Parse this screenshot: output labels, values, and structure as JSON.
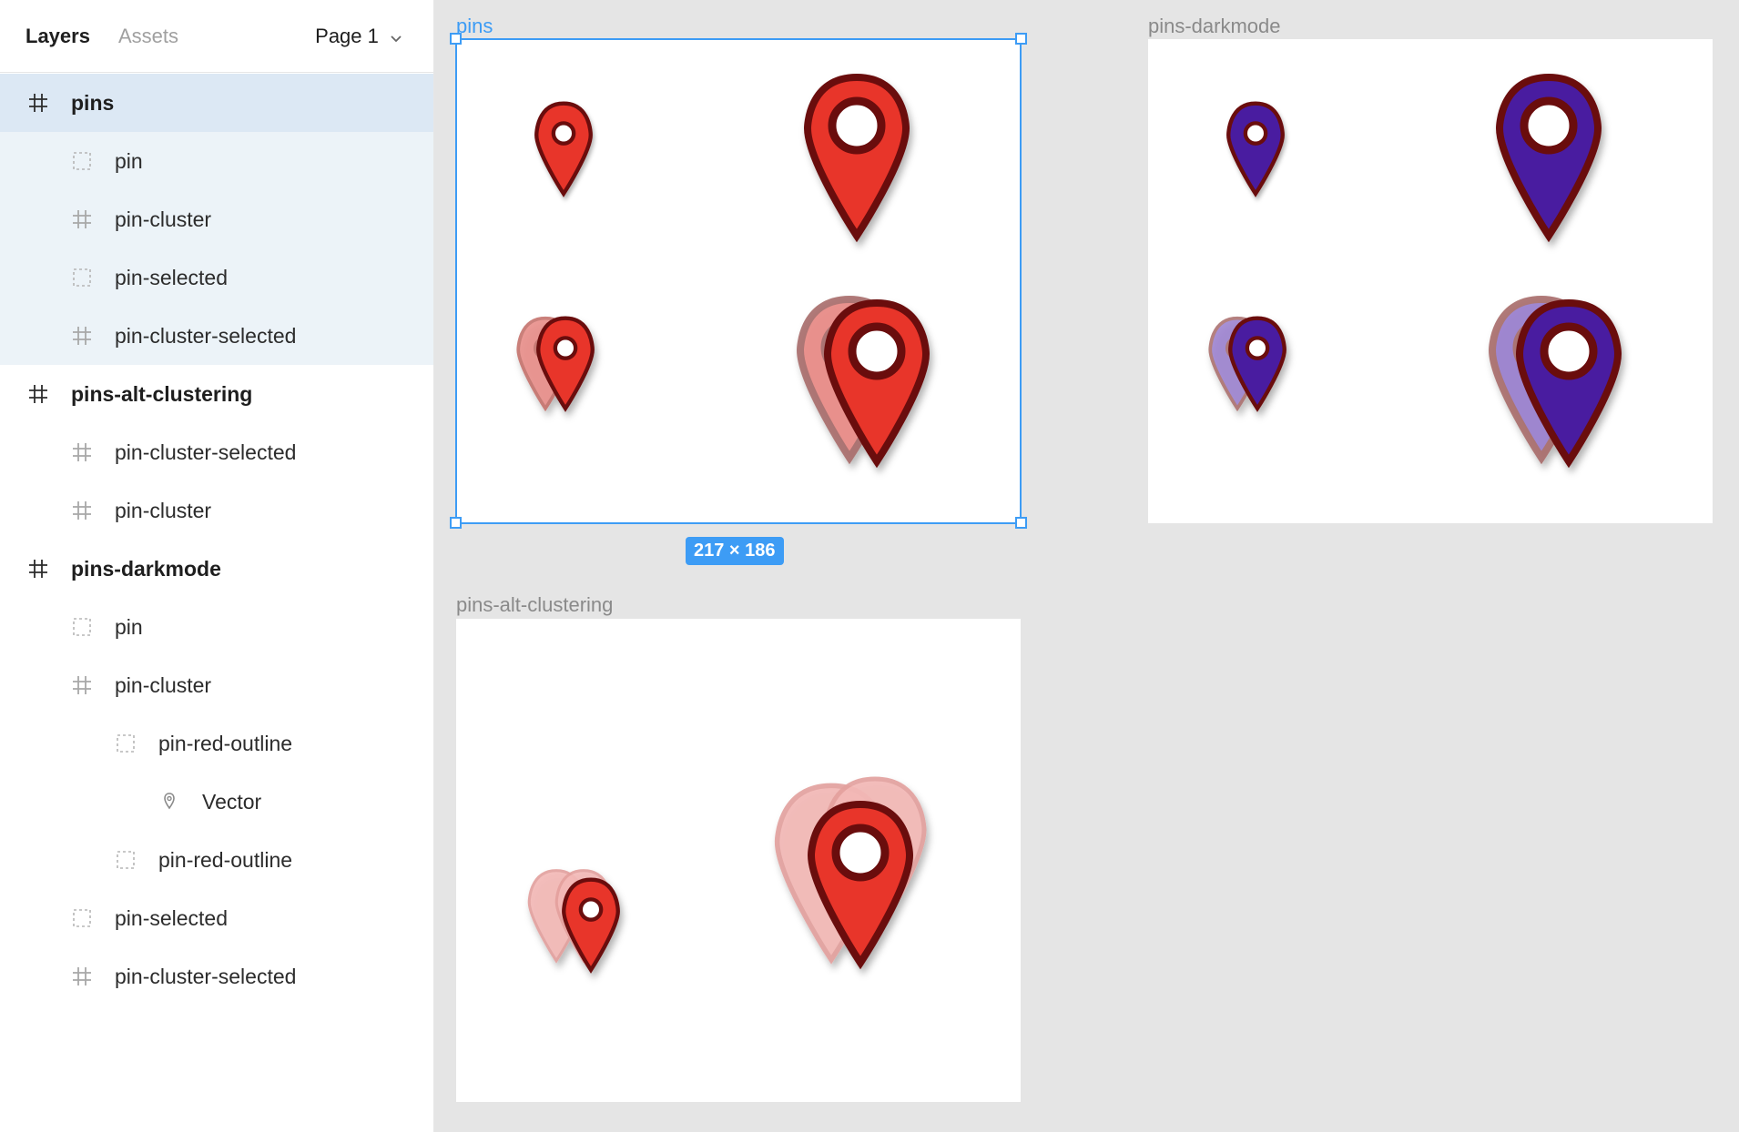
{
  "panel": {
    "tabs": {
      "layers": "Layers",
      "assets": "Assets"
    },
    "page_select": "Page 1",
    "layers": [
      {
        "label": "pins",
        "icon": "frame-icon",
        "indent": 0,
        "top_level": true,
        "state": "selected"
      },
      {
        "label": "pin",
        "icon": "component-icon",
        "indent": 1,
        "state": "child-selected"
      },
      {
        "label": "pin-cluster",
        "icon": "frame-icon",
        "indent": 1,
        "state": "child-selected"
      },
      {
        "label": "pin-selected",
        "icon": "component-icon",
        "indent": 1,
        "state": "child-selected"
      },
      {
        "label": "pin-cluster-selected",
        "icon": "frame-icon",
        "indent": 1,
        "state": "child-selected"
      },
      {
        "label": "pins-alt-clustering",
        "icon": "frame-icon",
        "indent": 0,
        "top_level": true,
        "state": ""
      },
      {
        "label": "pin-cluster-selected",
        "icon": "frame-icon",
        "indent": 1,
        "state": ""
      },
      {
        "label": "pin-cluster",
        "icon": "frame-icon",
        "indent": 1,
        "state": ""
      },
      {
        "label": "pins-darkmode",
        "icon": "frame-icon",
        "indent": 0,
        "top_level": true,
        "state": ""
      },
      {
        "label": "pin",
        "icon": "component-icon",
        "indent": 1,
        "state": ""
      },
      {
        "label": "pin-cluster",
        "icon": "frame-icon",
        "indent": 1,
        "state": ""
      },
      {
        "label": "pin-red-outline",
        "icon": "component-icon",
        "indent": 2,
        "state": ""
      },
      {
        "label": "Vector",
        "icon": "vector-pin-icon",
        "indent": 3,
        "state": ""
      },
      {
        "label": "pin-red-outline",
        "icon": "component-icon",
        "indent": 2,
        "state": ""
      },
      {
        "label": "pin-selected",
        "icon": "component-icon",
        "indent": 1,
        "state": ""
      },
      {
        "label": "pin-cluster-selected",
        "icon": "frame-icon",
        "indent": 1,
        "state": ""
      }
    ]
  },
  "canvas": {
    "frames": {
      "pins": {
        "title": "pins"
      },
      "pins_darkmode": {
        "title": "pins-darkmode"
      },
      "pins_alt": {
        "title": "pins-alt-clustering"
      }
    },
    "selection_size": "217 × 186"
  },
  "colors": {
    "accent": "#3d9cf5",
    "pin_red": "#e8342b",
    "pin_outline": "#6b0d0d",
    "pin_purple": "#4a1aa0",
    "pin_red_faded": "#e98a85",
    "pin_purple_faded": "#9a7fcf",
    "pin_pink_ghost": "#f3b8b6"
  }
}
